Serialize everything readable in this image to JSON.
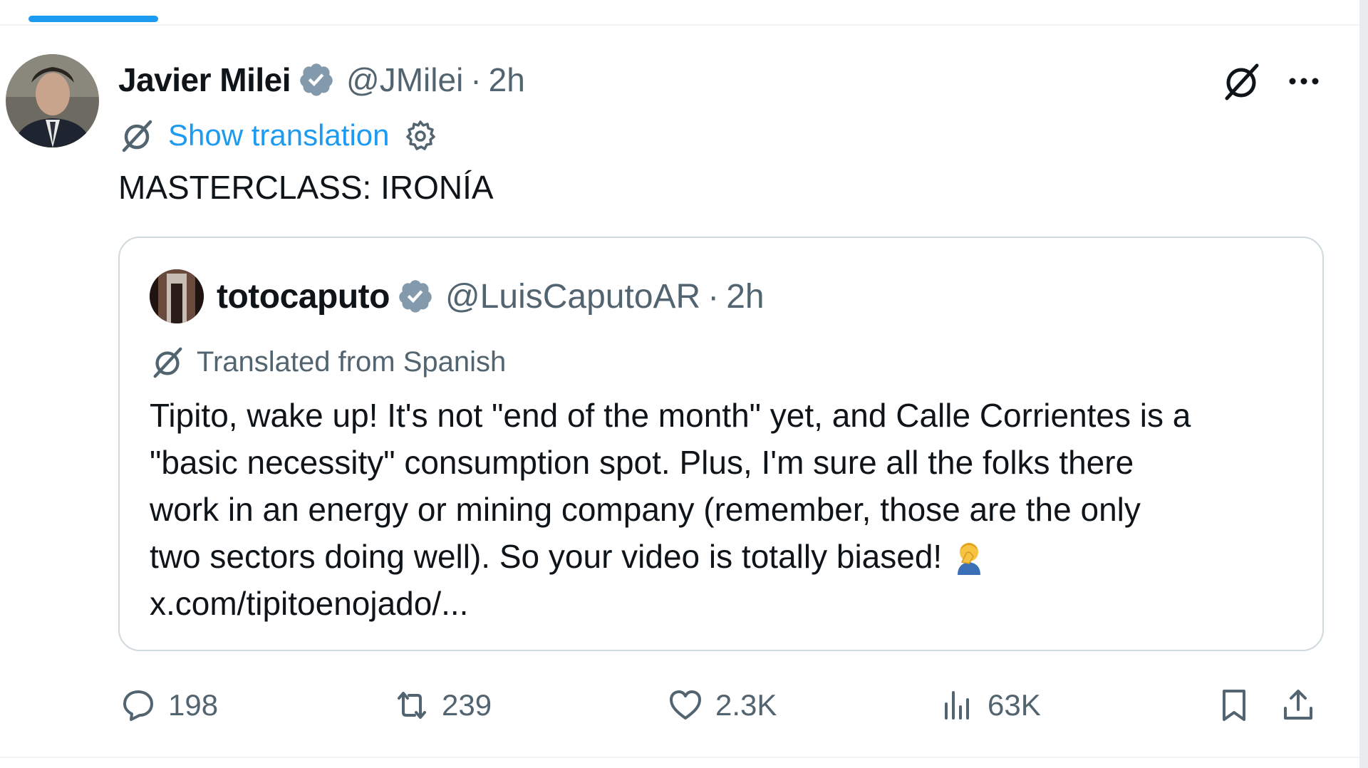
{
  "tweet": {
    "author_name": "Javier Milei",
    "author_handle": "@JMilei",
    "separator": "·",
    "time": "2h",
    "show_translation": "Show translation",
    "text": "MASTERCLASS: IRONÍA"
  },
  "quote": {
    "author_name": "totocaputo",
    "author_handle": "@LuisCaputoAR",
    "separator": "·",
    "time": "2h",
    "translated_label": "Translated from Spanish",
    "lines": [
      "Tipito, wake up! It's not \"end of the month\" yet, and Calle Corrientes is a",
      "\"basic necessity\" consumption spot. Plus, I'm sure all the folks there",
      "work in an energy or mining company (remember, those are the only",
      "two sectors doing well). So your video is totally biased!",
      "x.com/tipitoenojado/..."
    ]
  },
  "actions": {
    "replies": "198",
    "reposts": "239",
    "likes": "2.3K",
    "views": "63K"
  },
  "colors": {
    "accent": "#1d9bf0",
    "text": "#0f1419",
    "secondary": "#536471",
    "border": "#cfd9de"
  }
}
